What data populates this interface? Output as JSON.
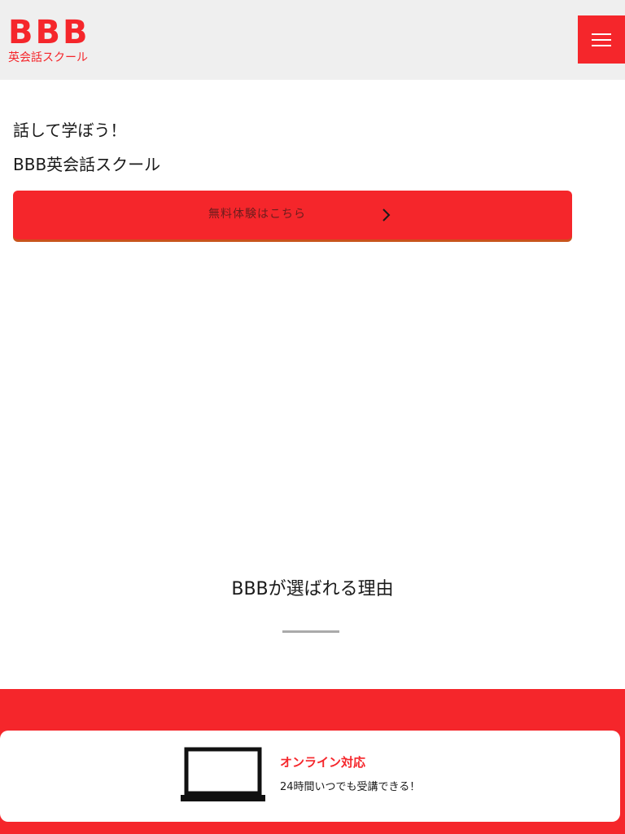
{
  "header": {
    "logo_mark": "BBB",
    "logo_subtitle": "英会話スクール",
    "menu_icon": "hamburger-menu-icon"
  },
  "hero": {
    "tagline": "話して学ぼう！",
    "school_name": "BBB英会話スクール",
    "cta_label": "無料体験はこちら",
    "cta_icon": "chevron-right-icon"
  },
  "reasons": {
    "title": "BBBが選ばれる理由",
    "features": [
      {
        "icon": "laptop-icon",
        "title": "オンライン対応",
        "description": "24時間いつでも受講できる！"
      }
    ]
  },
  "colors": {
    "brand_red": "#f5262b",
    "header_bg": "#efefef",
    "cta_shadow": "#c9541c",
    "divider": "#aaaaaa"
  }
}
